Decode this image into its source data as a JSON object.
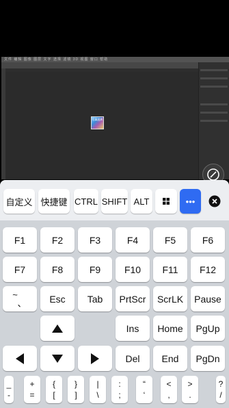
{
  "remote": {
    "ps_menu": "文件 编辑 图像 图层 文字 选择 滤镜 3D 视图 窗口 帮助",
    "thumb_text": "写真图库"
  },
  "toolbar": {
    "custom": "自定义",
    "shortcut": "快捷键",
    "ctrl": "CTRL",
    "shift": "SHIFT",
    "alt": "ALT",
    "more": "•••"
  },
  "keys": {
    "f1": "F1",
    "f2": "F2",
    "f3": "F3",
    "f4": "F4",
    "f5": "F5",
    "f6": "F6",
    "f7": "F7",
    "f8": "F8",
    "f9": "F9",
    "f10": "F10",
    "f11": "F11",
    "f12": "F12",
    "tilde_top": "~",
    "tilde_bottom": "、",
    "esc": "Esc",
    "tab": "Tab",
    "prtscr": "PrtScr",
    "scrlk": "ScrLK",
    "pause": "Pause",
    "ins": "Ins",
    "home": "Home",
    "pgup": "PgUp",
    "del": "Del",
    "end": "End",
    "pgdn": "PgDn"
  },
  "symbols": [
    {
      "top": "_",
      "bottom": "-"
    },
    {
      "top": "+",
      "bottom": "="
    },
    {
      "top": "{",
      "bottom": "["
    },
    {
      "top": "}",
      "bottom": "]"
    },
    {
      "top": "|",
      "bottom": "\\"
    },
    {
      "top": ":",
      "bottom": ";"
    },
    {
      "top": "“",
      "bottom": "‘"
    },
    {
      "top": "<",
      "bottom": ","
    },
    {
      "top": ">",
      "bottom": "."
    },
    {
      "top": "?",
      "bottom": "/"
    }
  ],
  "colors": {
    "accent": "#2f6bf2",
    "keyboard_bg": "#cfd3d8",
    "toolbar_bg": "#eceef1"
  },
  "icons": {
    "windows": "windows-icon",
    "close": "close-circle-icon",
    "arrows": [
      "arrow-up-icon",
      "arrow-left-icon",
      "arrow-down-icon",
      "arrow-right-icon"
    ],
    "fab": "pen-circle-icon"
  }
}
